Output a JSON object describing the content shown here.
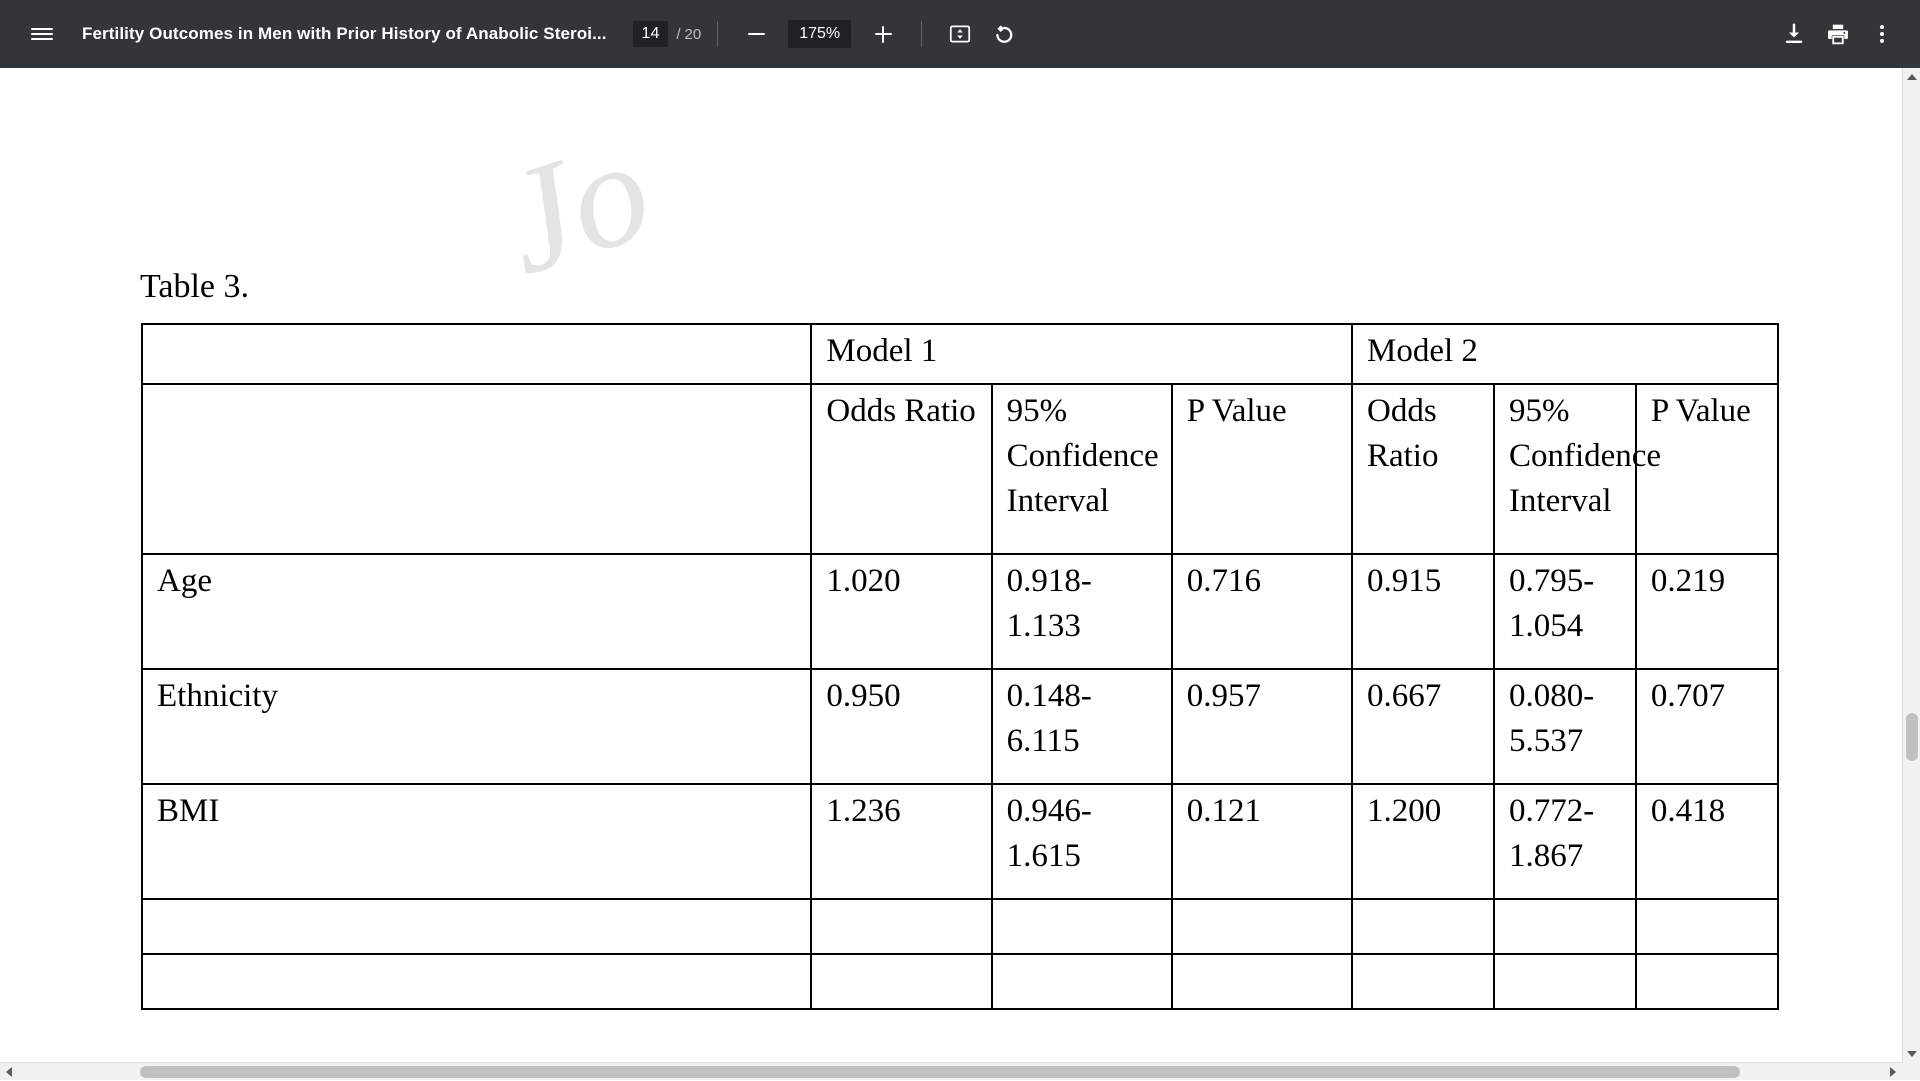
{
  "toolbar": {
    "menu_icon": "hamburger-menu-icon",
    "document_title": "Fertility Outcomes in Men with Prior History of Anabolic Steroi...",
    "page_current": "14",
    "page_separator": "/",
    "page_total": "20",
    "zoom_out_icon": "minus-icon",
    "zoom_level": "175%",
    "zoom_in_icon": "plus-icon",
    "fit_page_icon": "fit-to-page-icon",
    "rotate_icon": "rotate-counterclockwise-icon",
    "download_icon": "download-icon",
    "print_icon": "print-icon",
    "more_icon": "more-vertical-icon",
    "bg_color": "#323639",
    "field_bg_color": "#202124"
  },
  "document": {
    "watermark_text": "Jo",
    "caption": "Table 3.",
    "table": {
      "group_header": {
        "corner": "",
        "model_1": "Model 1",
        "model_2": "Model 2"
      },
      "column_headers": [
        "",
        "Odds Ratio",
        "95% Confidence Interval",
        "P Value",
        "Odds Ratio",
        "95% Confidence Interval",
        "P Value"
      ],
      "rows": [
        {
          "label": "Age",
          "m1_odds_ratio": "1.020",
          "m1_ci": "0.918-1.133",
          "m1_p": "0.716",
          "m2_odds_ratio": "0.915",
          "m2_ci": "0.795-1.054",
          "m2_p": "0.219"
        },
        {
          "label": "Ethnicity",
          "m1_odds_ratio": "0.950",
          "m1_ci": "0.148-6.115",
          "m1_p": "0.957",
          "m2_odds_ratio": "0.667",
          "m2_ci": "0.080-5.537",
          "m2_p": "0.707"
        },
        {
          "label": "BMI",
          "m1_odds_ratio": "1.236",
          "m1_ci": "0.946-1.615",
          "m1_p": "0.121",
          "m2_odds_ratio": "1.200",
          "m2_ci": "0.772-1.867",
          "m2_p": "0.418"
        },
        {
          "label": "",
          "m1_odds_ratio": "",
          "m1_ci": "",
          "m1_p": "",
          "m2_odds_ratio": "",
          "m2_ci": "",
          "m2_p": ""
        },
        {
          "label": "",
          "m1_odds_ratio": "",
          "m1_ci": "",
          "m1_p": "",
          "m2_odds_ratio": "",
          "m2_ci": "",
          "m2_p": ""
        }
      ]
    }
  },
  "scrollbars": {
    "vertical_up_icon": "scroll-up-arrow-icon",
    "vertical_down_icon": "scroll-down-arrow-icon",
    "horizontal_left_icon": "scroll-left-arrow-icon",
    "horizontal_right_icon": "scroll-right-arrow-icon",
    "track_color": "#f1f1f1",
    "thumb_color": "#c1c1c1"
  }
}
